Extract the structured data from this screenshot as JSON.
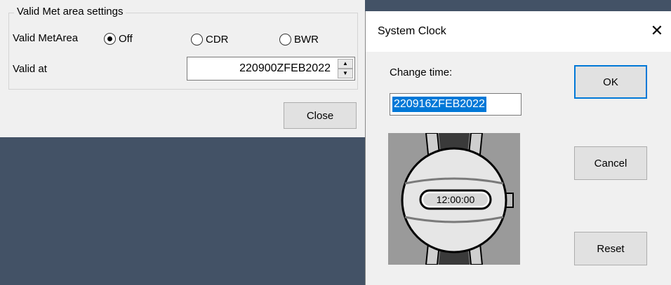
{
  "settings": {
    "group_title": "Valid Met area settings",
    "valid_metarea_label": "Valid MetArea",
    "radio_options": [
      {
        "label": "Off",
        "checked": true
      },
      {
        "label": "CDR",
        "checked": false
      },
      {
        "label": "BWR",
        "checked": false
      }
    ],
    "valid_at_label": "Valid at",
    "valid_at_value": "220900ZFEB2022",
    "close_label": "Close"
  },
  "dialog": {
    "title": "System Clock",
    "close_glyph": "✕",
    "change_time_label": "Change time:",
    "time_value": "220916ZFEB2022",
    "watch_time": "12:00:00",
    "ok_label": "OK",
    "cancel_label": "Cancel",
    "reset_label": "Reset"
  },
  "colors": {
    "desktop": "#435266",
    "selection": "#0078d7"
  }
}
